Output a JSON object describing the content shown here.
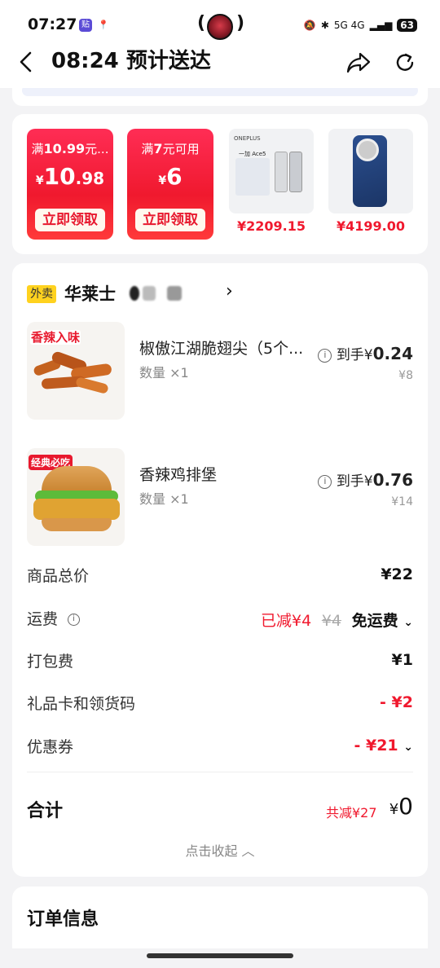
{
  "status_bar": {
    "time": "07:27",
    "app_badges": [
      "贴",
      "📍"
    ],
    "network": "5G 4G",
    "battery": "63"
  },
  "header": {
    "title": "08:24 预计送达",
    "back_icon": "chevron-left-icon",
    "share_icon": "share-icon",
    "refresh_icon": "refresh-icon"
  },
  "promotions": {
    "coupons": [
      {
        "condition_prefix": "满",
        "condition_amount": "10.99",
        "condition_suffix": "元...",
        "yen": "¥",
        "amount_int": "10",
        "amount_dec": ".98",
        "button": "立即领取"
      },
      {
        "condition_prefix": "满",
        "condition_amount": "7",
        "condition_suffix": "元可用",
        "yen": "¥",
        "amount_int": "6",
        "amount_dec": "",
        "button": "立即领取"
      }
    ],
    "products": [
      {
        "price": "¥2209.15",
        "brand": "ONEPLUS",
        "model": "一加 Ace5"
      },
      {
        "price": "¥4199.00"
      }
    ]
  },
  "order": {
    "store_tag": "外卖",
    "store_name": "华莱士",
    "items": [
      {
        "name": "椒傲江湖脆翅尖（5个...",
        "qty": "数量 ×1",
        "price_prefix": "到手¥",
        "price": "0.24",
        "original": "¥8",
        "badge": "香辣入味"
      },
      {
        "name": "香辣鸡排堡",
        "qty": "数量 ×1",
        "price_prefix": "到手¥",
        "price": "0.76",
        "original": "¥14",
        "badge": "经典必吃"
      }
    ],
    "fees": {
      "subtotal_label": "商品总价",
      "subtotal_value": "¥22",
      "delivery_label": "运费",
      "delivery_discount": "已减¥4",
      "delivery_original": "¥4",
      "delivery_value": "免运费",
      "packing_label": "打包费",
      "packing_value": "¥1",
      "giftcard_label": "礼品卡和领货码",
      "giftcard_value": "- ¥2",
      "coupon_label": "优惠券",
      "coupon_value": "- ¥21"
    },
    "total": {
      "label": "合计",
      "saved": "共减¥27",
      "yen": "¥",
      "value": "0"
    },
    "collapse_label": "点击收起"
  },
  "order_info": {
    "title": "订单信息"
  },
  "colors": {
    "accent_red": "#f0192e",
    "tag_yellow": "#ffd21f",
    "background": "#f3f3f5"
  }
}
